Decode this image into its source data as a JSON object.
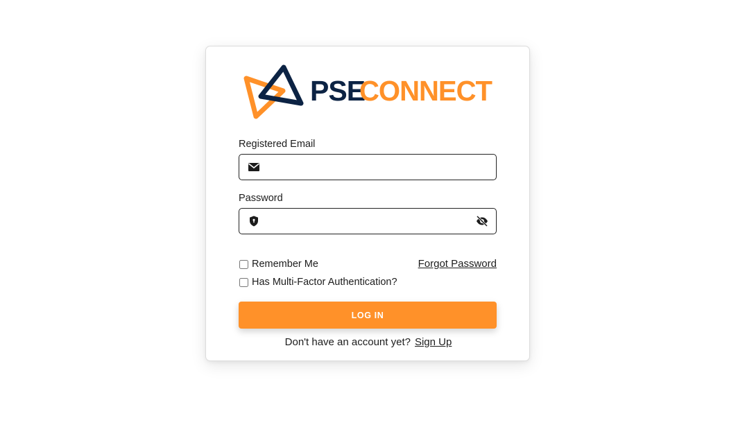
{
  "brand": {
    "name_dark": "PSE",
    "name_accent": "CONNECT",
    "dark_color": "#0c2344",
    "accent_color": "#ff9129"
  },
  "form": {
    "email_label": "Registered Email",
    "email_value": "",
    "email_icon": "envelope-icon",
    "password_label": "Password",
    "password_value": "",
    "password_icon": "shield-icon",
    "password_toggle_icon": "eye-slash-icon",
    "remember_label": "Remember Me",
    "remember_checked": false,
    "mfa_label": "Has Multi-Factor Authentication?",
    "mfa_checked": false,
    "forgot_label": "Forgot Password",
    "login_label": "LOG IN"
  },
  "signup": {
    "prompt": "Don't have an account yet?",
    "link_label": "Sign Up"
  }
}
